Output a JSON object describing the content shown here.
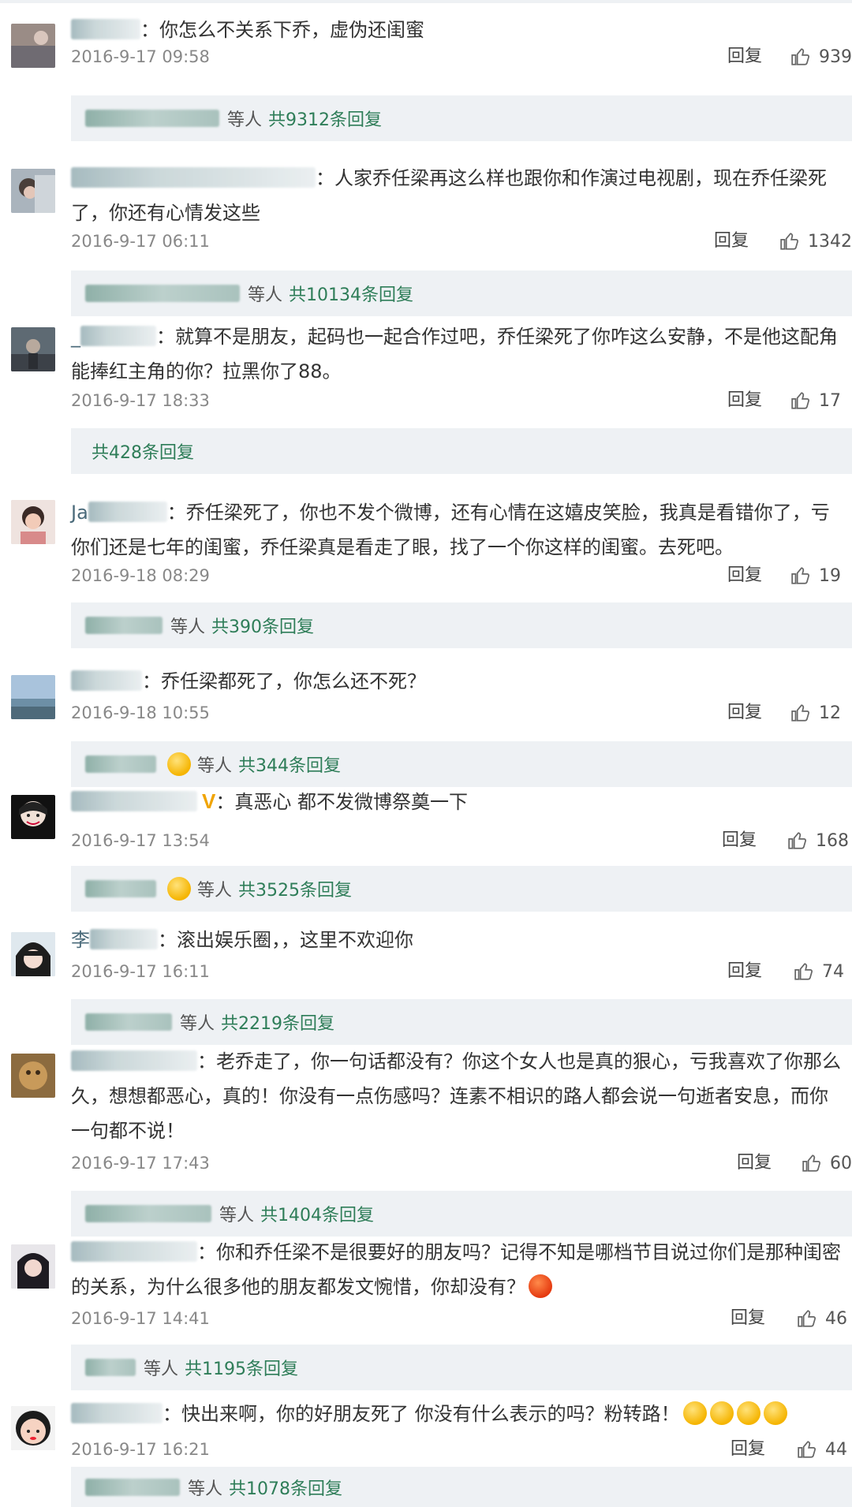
{
  "comments": [
    {
      "text": "：你怎么不关系下乔，虚伪还闺蜜",
      "date": "2016-9-17 09:58",
      "reply": "回复",
      "likes": "939",
      "replies_pre": "等人",
      "replies_count": "共9312条回复"
    },
    {
      "text": "：人家乔任梁再这么样也跟你和作演过电视剧，现在乔任梁死了，你还有心情发这些",
      "date": "2016-9-17 06:11",
      "reply": "回复",
      "likes": "1342",
      "replies_pre": "等人",
      "replies_count": "共10134条回复"
    },
    {
      "text": "：就算不是朋友，起码也一起合作过吧，乔任梁死了你咋这么安静，不是他这配角能捧红主角的你？拉黑你了88。",
      "date": "2016-9-17 18:33",
      "reply": "回复",
      "likes": "17",
      "replies_pre": "",
      "replies_count": "共428条回复"
    },
    {
      "text": "：乔任梁死了，你也不发个微博，还有心情在这嬉皮笑脸，我真是看错你了，亏你们还是七年的闺蜜，乔任梁真是看走了眼，找了一个你这样的闺蜜。去死吧。",
      "date": "2016-9-18 08:29",
      "reply": "回复",
      "likes": "19",
      "replies_pre": "等人",
      "replies_count": "共390条回复"
    },
    {
      "text": "：乔任梁都死了，你怎么还不死？",
      "date": "2016-9-18 10:55",
      "reply": "回复",
      "likes": "12",
      "replies_pre": "等人",
      "replies_count": "共344条回复"
    },
    {
      "text": "：真恶心 都不发微博祭奠一下",
      "date": "2016-9-17 13:54",
      "reply": "回复",
      "likes": "168",
      "replies_pre": "等人",
      "replies_count": "共3525条回复"
    },
    {
      "text": "：滚出娱乐圈，，这里不欢迎你",
      "date": "2016-9-17 16:11",
      "reply": "回复",
      "likes": "74",
      "replies_pre": "等人",
      "replies_count": "共2219条回复"
    },
    {
      "text": "：老乔走了，你一句话都没有？你这个女人也是真的狠心，亏我喜欢了你那么久，想想都恶心，真的！你没有一点伤感吗？连素不相识的路人都会说一句逝者安息，而你一句都不说！",
      "date": "2016-9-17 17:43",
      "reply": "回复",
      "likes": "60",
      "replies_pre": "等人",
      "replies_count": "共1404条回复"
    },
    {
      "text": "：你和乔任梁不是很要好的朋友吗？记得不知是哪档节目说过你们是那种闺密的关系，为什么很多他的朋友都发文惋惜，你却没有？",
      "date": "2016-9-17 14:41",
      "reply": "回复",
      "likes": "46",
      "replies_pre": "等人",
      "replies_count": "共1195条回复"
    },
    {
      "text": "：快出来啊，你的好朋友死了 你没有什么表示的吗？粉转路！",
      "date": "2016-9-17 16:21",
      "reply": "回复",
      "likes": "44",
      "replies_pre": "等人",
      "replies_count": "共1078条回复"
    }
  ],
  "colors": {
    "background": "#ffffff",
    "reply_bar": "#eef1f4",
    "reply_count_green": "#2e7d58",
    "date_gray": "#888888"
  }
}
